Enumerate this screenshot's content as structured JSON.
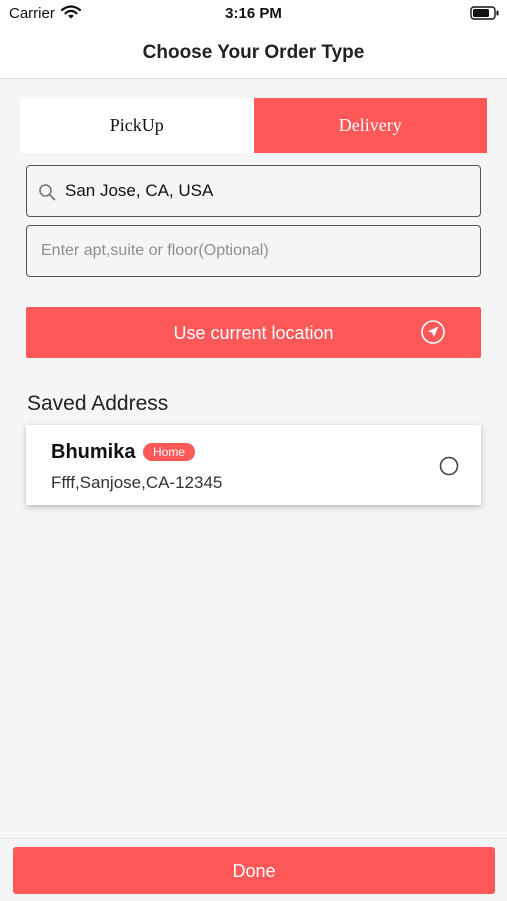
{
  "status_bar": {
    "carrier": "Carrier",
    "time": "3:16 PM",
    "icons": [
      "wifi-icon",
      "battery-icon"
    ]
  },
  "header": {
    "title": "Choose Your Order Type"
  },
  "tabs": [
    {
      "label": "PickUp",
      "selected": false
    },
    {
      "label": "Delivery",
      "selected": true
    }
  ],
  "address_form": {
    "search_value": "San Jose, CA, USA",
    "search_icon": "search-icon",
    "apt_placeholder": "Enter apt,suite or floor(Optional)",
    "apt_value": ""
  },
  "current_location": {
    "label": "Use current location",
    "icon": "navigation-arrow-icon"
  },
  "saved": {
    "title": "Saved Address",
    "items": [
      {
        "name": "Bhumika",
        "badge": "Home",
        "address": "Ffff,Sanjose,CA-12345",
        "selected": false
      }
    ]
  },
  "footer": {
    "done_label": "Done"
  },
  "colors": {
    "accent": "#fe5858",
    "background": "#f5f5f5",
    "surface": "#ffffff"
  }
}
